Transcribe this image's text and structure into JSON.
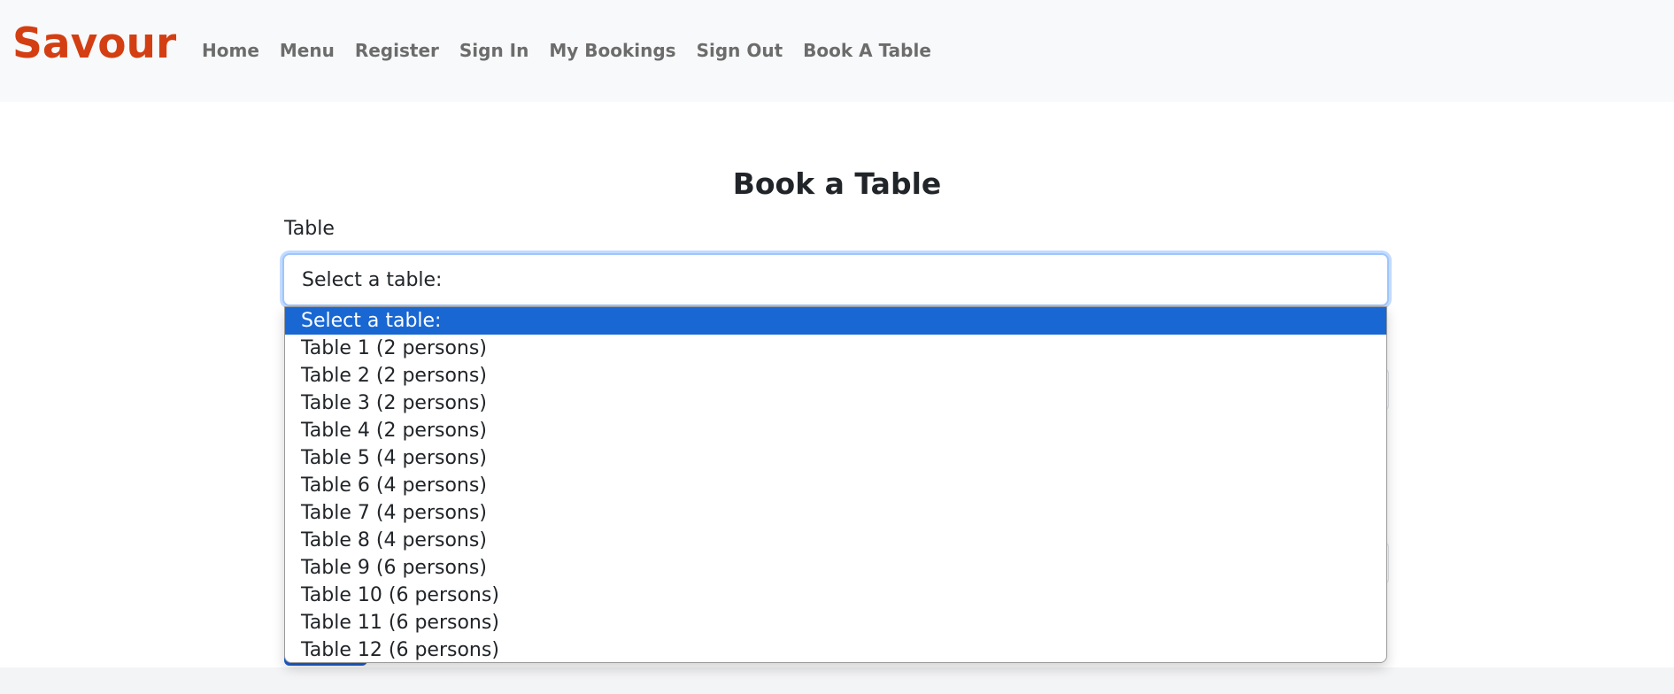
{
  "navbar": {
    "brand": "Savour",
    "links": [
      "Home",
      "Menu",
      "Register",
      "Sign In",
      "My Bookings",
      "Sign Out",
      "Book A Table"
    ]
  },
  "form": {
    "title": "Book a Table",
    "table_label": "Table",
    "table_select_value": "Select a table:",
    "options": [
      "Select a table:",
      "Table 1 (2 persons)",
      "Table 2 (2 persons)",
      "Table 3 (2 persons)",
      "Table 4 (2 persons)",
      "Table 5 (4 persons)",
      "Table 6 (4 persons)",
      "Table 7 (4 persons)",
      "Table 8 (4 persons)",
      "Table 9 (6 persons)",
      "Table 10 (6 persons)",
      "Table 11 (6 persons)",
      "Table 12 (6 persons)"
    ],
    "highlighted_option_index": 0
  },
  "colors": {
    "brand": "#d33f12",
    "nav_link": "#6c6c6c",
    "highlight": "#1967d2"
  }
}
